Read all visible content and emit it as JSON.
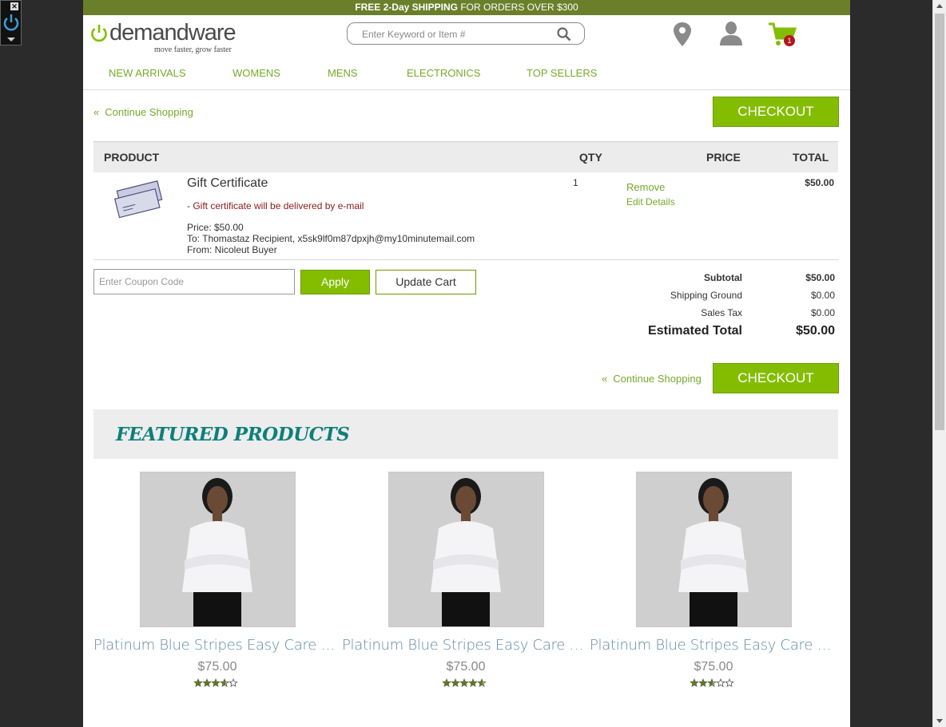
{
  "promo": {
    "bold": "FREE 2-Day SHIPPING",
    "rest": " FOR ORDERS OVER $300"
  },
  "logo": {
    "word_a": "demand",
    "word_b": "ware",
    "tagline": "move faster, grow faster"
  },
  "search": {
    "placeholder": "Enter Keyword or Item #"
  },
  "header_icons": [
    "location-icon",
    "user-icon",
    "cart-icon"
  ],
  "cart_count": "1",
  "nav": [
    "NEW ARRIVALS",
    "WOMENS",
    "MENS",
    "ELECTRONICS",
    "TOP SELLERS"
  ],
  "continue_shopping": "Continue Shopping",
  "checkout": "CHECKOUT",
  "table_headers": {
    "product": "PRODUCT",
    "qty": "QTY",
    "price": "PRICE",
    "total": "TOTAL"
  },
  "item": {
    "name": "Gift Certificate",
    "delivery": "- Gift certificate will be delivered by e-mail",
    "price": "Price: $50.00",
    "to": "To: Thomastaz Recipient, x5sk9lf0m87dpxjh@my10minutemail.com",
    "from": "From: Nicoleut Buyer",
    "qty": "1",
    "remove": "Remove",
    "edit": "Edit Details",
    "total": "$50.00"
  },
  "coupon": {
    "placeholder": "Enter Coupon Code",
    "apply": "Apply",
    "update": "Update Cart"
  },
  "summary": {
    "subtotal_label": "Subtotal",
    "subtotal": "$50.00",
    "shipping_label": "Shipping Ground",
    "shipping": "$0.00",
    "tax_label": "Sales Tax",
    "tax": "$0.00",
    "estimated_label": "Estimated Total",
    "estimated": "$50.00"
  },
  "featured_title": "FEATURED PRODUCTS",
  "products": [
    {
      "name": "Platinum Blue Stripes Easy Care Fitted Shirt",
      "price": "$75.00",
      "rating": 3.5
    },
    {
      "name": "Platinum Blue Stripes Easy Care Fitted Shirt",
      "price": "$75.00",
      "rating": 4.5
    },
    {
      "name": "Platinum Blue Stripes Easy Care Fitted Shirt",
      "price": "$75.00",
      "rating": 2.5
    }
  ],
  "colors": {
    "accent": "#84bd00",
    "link": "#76a92b",
    "promo": "#6a7f2a",
    "featured": "#0e7f7a"
  }
}
